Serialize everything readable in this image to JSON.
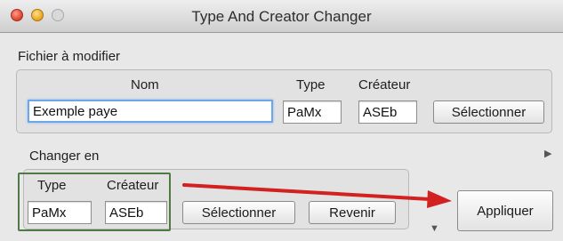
{
  "window": {
    "title": "Type And Creator Changer"
  },
  "source_group": {
    "label": "Fichier à modifier",
    "col_name": "Nom",
    "col_type": "Type",
    "col_creator": "Créateur",
    "name_value": "Exemple paye",
    "type_value": "PaMx",
    "creator_value": "ASEb",
    "select_label": "Sélectionner"
  },
  "target_group": {
    "label": "Changer en",
    "col_type": "Type",
    "col_creator": "Créateur",
    "type_value": "PaMx",
    "creator_value": "ASEb",
    "select_label": "Sélectionner",
    "revert_label": "Revenir"
  },
  "apply_label": "Appliquer",
  "icons": {
    "disclosure_right": "triangle-right-icon",
    "disclosure_down": "triangle-down-icon",
    "annotation_arrow": "red-arrow"
  },
  "colors": {
    "annotation_arrow": "#d32020",
    "highlight_box": "#4f7a43",
    "focus_ring": "#6fa6e8"
  }
}
